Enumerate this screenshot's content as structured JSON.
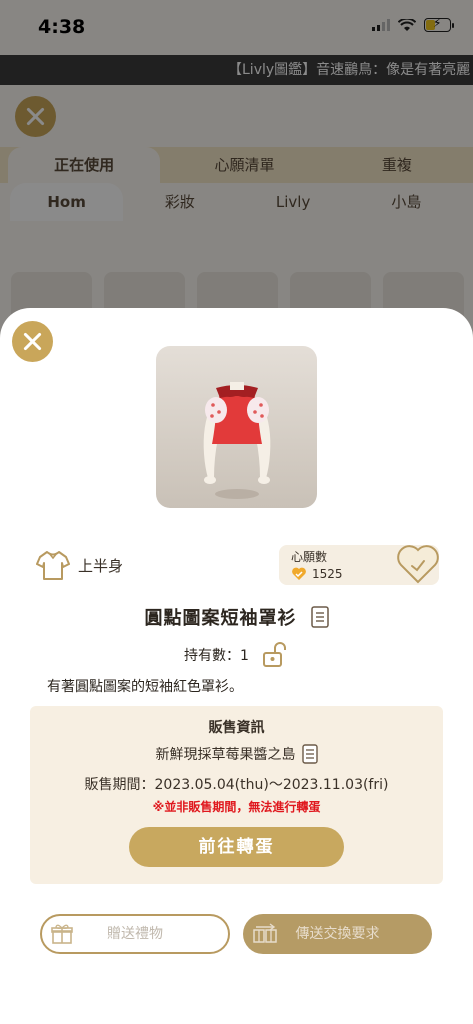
{
  "status_bar": {
    "time": "4:38"
  },
  "ticker": {
    "text": "【Livly圖鑑】音速鸝鳥：像是有著亮麗"
  },
  "background": {
    "main_tabs": [
      "正在使用",
      "心願清單",
      "重複"
    ],
    "sub_tabs": [
      "Hom",
      "彩妝",
      "Livly",
      "小島"
    ]
  },
  "item": {
    "category": "上半身",
    "name": "圓點圖案短袖罩衫",
    "owned": "持有數：1",
    "description": "有著圓點圖案的短袖紅色罩衫。"
  },
  "wishlist": {
    "label": "心願數",
    "count": "1525"
  },
  "sale": {
    "title": "販售資訊",
    "place": "新鮮現採草莓果醬之島",
    "period": "販售期間：2023.05.04(thu)～2023.11.03(fri)",
    "warning": "※並非販售期間，無法進行轉蛋",
    "gacha_button": "前往轉蛋"
  },
  "actions": {
    "gift": "贈送禮物",
    "trade": "傳送交換要求"
  },
  "colors": {
    "gold": "#c8a85f",
    "warning": "#e0181e",
    "heart": "#f0a92c"
  },
  "icons": [
    "close-icon",
    "shirt-icon",
    "heart-icon",
    "check-icon",
    "document-icon",
    "unlock-icon",
    "gift-icon",
    "exchange-icon",
    "wifi-icon",
    "signal-icon",
    "battery-icon"
  ]
}
